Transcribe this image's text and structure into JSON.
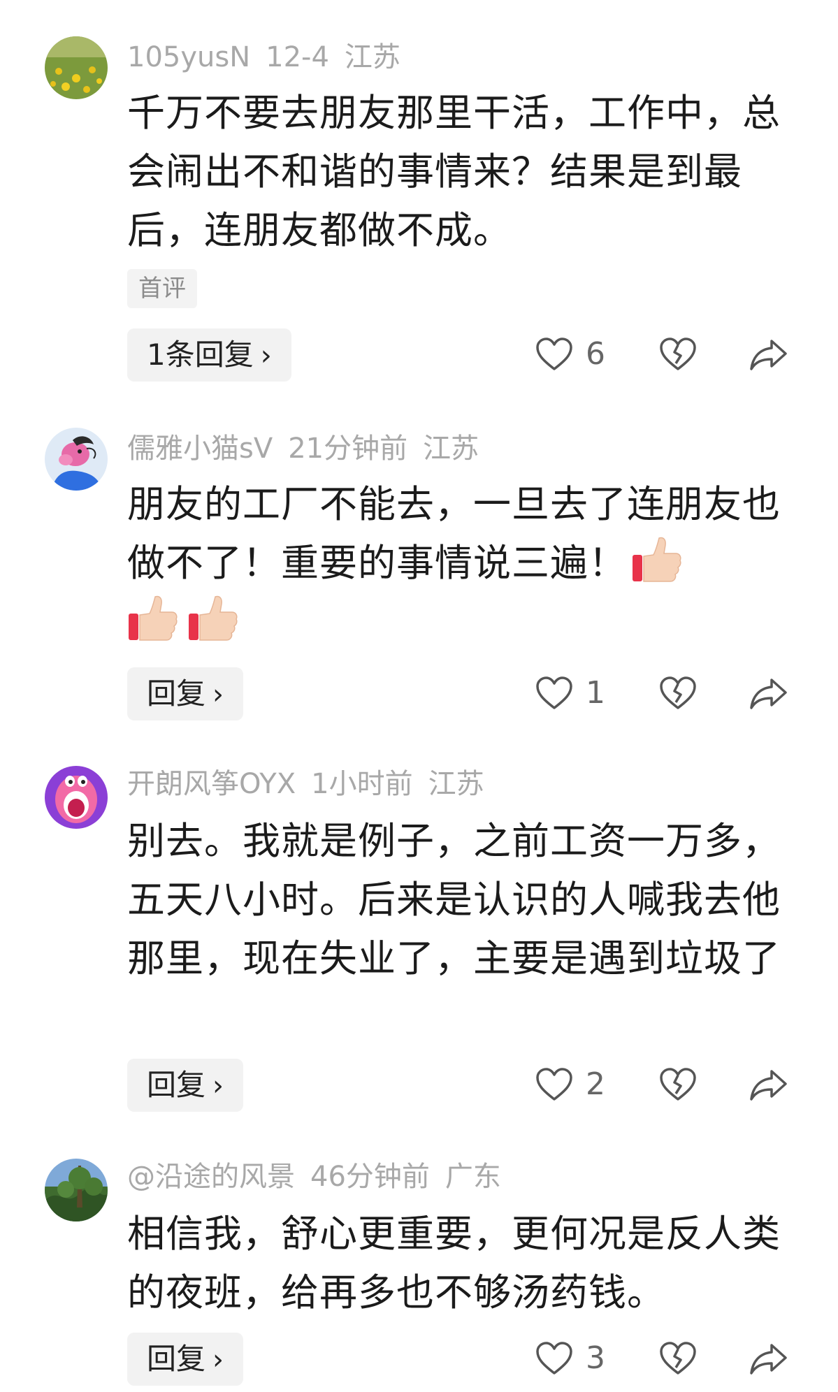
{
  "comments": [
    {
      "username": "105yusN",
      "time": "12-4",
      "location": "江苏",
      "text": "千万不要去朋友那里干活，工作中，总会闹出不和谐的事情来？结果是到最后，连朋友都做不成。",
      "tag": "首评",
      "reply_label": "1条回复",
      "likes": "6"
    },
    {
      "username": "儒雅小猫sV",
      "time": "21分钟前",
      "location": "江苏",
      "text": "朋友的工厂不能去，一旦去了连朋友也做不了！重要的事情说三遍！",
      "emojis": [
        "thumbs-up-icon",
        "thumbs-up-icon",
        "thumbs-up-icon"
      ],
      "reply_label": "回复",
      "likes": "1"
    },
    {
      "username": "开朗风筝OYX",
      "time": "1小时前",
      "location": "江苏",
      "text": "别去。我就是例子，之前工资一万多，五天八小时。后来是认识的人喊我去他那里，现在失业了，主要是遇到垃圾了",
      "reply_label": "回复",
      "likes": "2"
    },
    {
      "username": "@沿途的风景",
      "time": "46分钟前",
      "location": "广东",
      "text": "相信我，舒心更重要，更何况是反人类的夜班，给再多也不够汤药钱。",
      "reply_label": "回复",
      "likes": "3"
    }
  ],
  "icons": {
    "chevron": "chevron-right-icon",
    "like": "heart-outline-icon",
    "dislike": "broken-heart-icon",
    "share": "share-arrow-icon"
  },
  "colors": {
    "meta_text": "#a8a8a8",
    "button_bg": "#f2f2f2",
    "icon_stroke": "#555555"
  }
}
